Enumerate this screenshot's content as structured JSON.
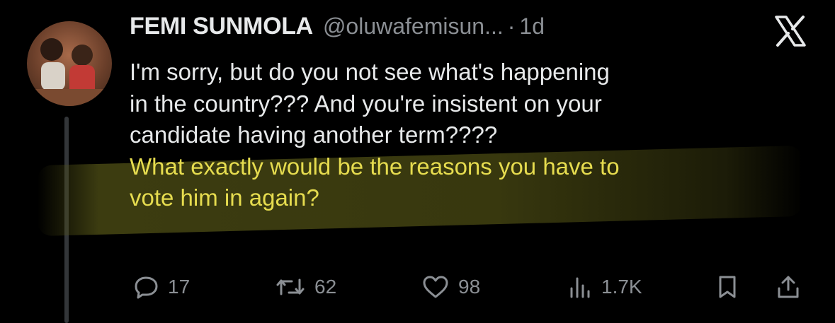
{
  "tweet": {
    "author_name": "FEMI SUNMOLA",
    "handle": "@oluwafemisun...",
    "separator": "·",
    "time": "1d",
    "text_lines": [
      "I'm sorry, but do you not see what's happening",
      "in the country??? And you're insistent on your",
      "candidate having another term????"
    ],
    "highlighted_lines": [
      "What exactly would be the reasons you have to",
      "vote him in again?"
    ],
    "highlight_color": "#e6dc4f"
  },
  "actions": {
    "replies": "17",
    "reposts": "62",
    "likes": "98",
    "views": "1.7K"
  },
  "icons": [
    "avatar",
    "x-logo-icon",
    "reply-icon",
    "repost-icon",
    "like-icon",
    "views-icon",
    "bookmark-icon",
    "share-icon"
  ],
  "colors": {
    "background": "#000000",
    "text": "#e7e9ea",
    "muted": "#8b8f94"
  }
}
